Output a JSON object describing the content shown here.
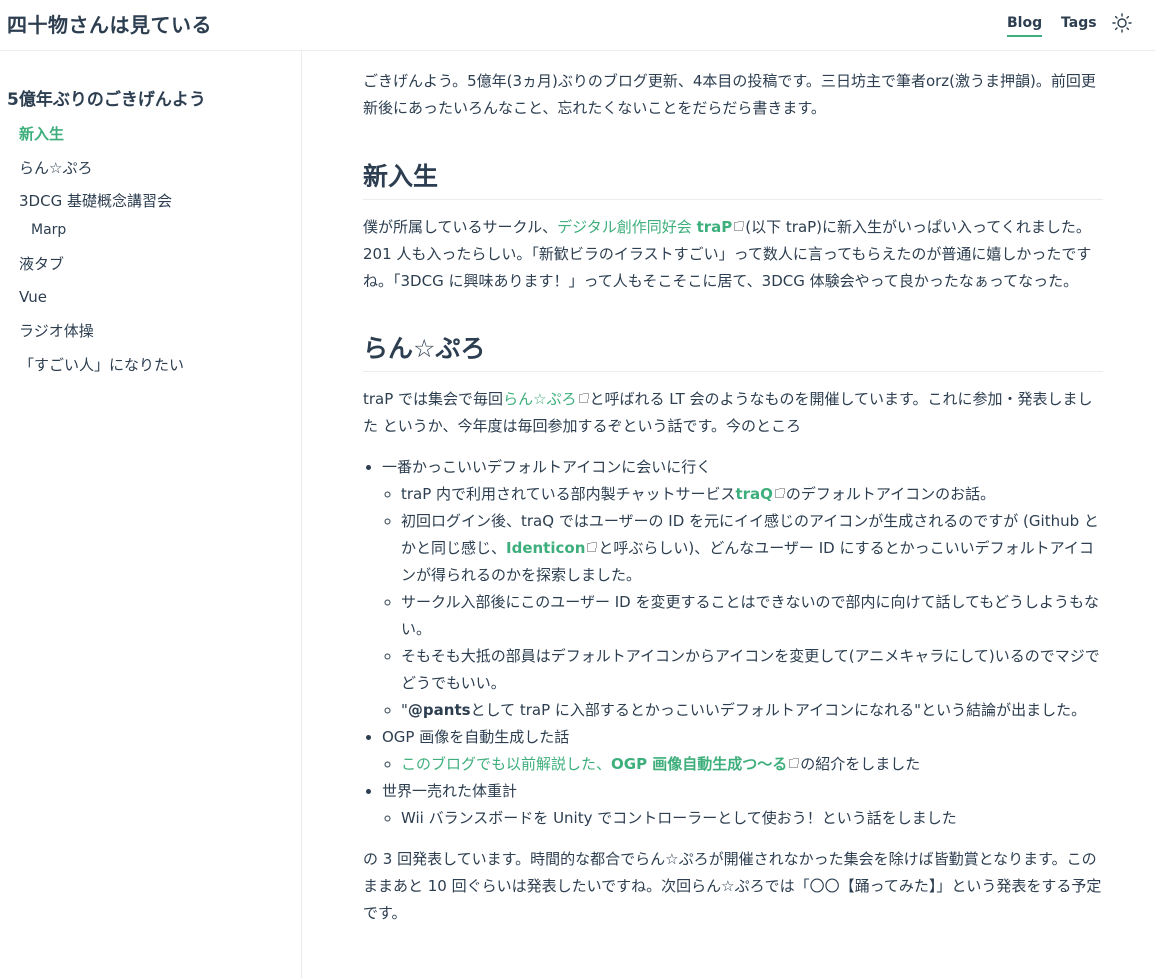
{
  "header": {
    "site_title": "四十物さんは見ている",
    "nav": [
      {
        "label": "Blog",
        "active": true
      },
      {
        "label": "Tags",
        "active": false
      }
    ],
    "theme_icon": "sun-icon"
  },
  "sidebar": {
    "title": "5億年ぶりのごきげんよう",
    "items": [
      {
        "label": "新入生",
        "active": true
      },
      {
        "label": "らん☆ぷろ"
      },
      {
        "label": "3DCG 基礎概念講習会"
      },
      {
        "label": "Marp",
        "sub": true
      },
      {
        "label": "液タブ"
      },
      {
        "label": "Vue"
      },
      {
        "label": "ラジオ体操"
      },
      {
        "label": "「すごい人」になりたい"
      }
    ]
  },
  "content": {
    "intro": "ごきげんよう。5億年(3ヵ月)ぶりのブログ更新、4本目の投稿です。三日坊主で筆者orz(激うま押韻)。前回更新後にあったいろんなこと、忘れたくないことをだらだら書きます。",
    "section1": {
      "heading": "新入生",
      "p_before": "僕が所属しているサークル、",
      "link1": "デジタル創作同好会",
      "link2": "traP",
      "p_after": "(以下 traP)に新入生がいっぱい入ってくれました。201 人も入ったらしい。「新歓ビラのイラストすごい」って数人に言ってもらえたのが普通に嬉しかったですね。「3DCG に興味あります！」って人もそこそこに居て、3DCG 体験会やって良かったなぁってなった。"
    },
    "section2": {
      "heading": "らん☆ぷろ",
      "p_before": "traP では集会で毎回",
      "link": "らん☆ぷろ",
      "p_after": "と呼ばれる LT 会のようなものを開催しています。これに参加・発表しました というか、今年度は毎回参加するぞという話です。今のところ",
      "list": {
        "item1": "一番かっこいいデフォルトアイコンに会いに行く",
        "item1_sub1_before": "traP 内で利用されている部内製チャットサービス",
        "item1_sub1_link": "traQ",
        "item1_sub1_after": "のデフォルトアイコンのお話。",
        "item1_sub2_before": "初回ログイン後、traQ ではユーザーの ID を元にイイ感じのアイコンが生成されるのですが (Github とかと同じ感じ、",
        "item1_sub2_link": "Identicon",
        "item1_sub2_after": "と呼ぶらしい)、どんなユーザー ID にするとかっこいいデフォルトアイコンが得られるのかを探索しました。",
        "item1_sub3": "サークル入部後にこのユーザー ID を変更することはできないので部内に向けて話してもどうしようもない。",
        "item1_sub4": "そもそも大抵の部員はデフォルトアイコンからアイコンを変更して(アニメキャラにして)いるのでマジでどうでもいい。",
        "item1_sub5_before": "\"",
        "item1_sub5_bold": "@pants",
        "item1_sub5_after": "として traP に入部するとかっこいいデフォルトアイコンになれる\"という結論が出ました。",
        "item2": "OGP 画像を自動生成した話",
        "item2_sub1_link_a": "このブログでも以前解説した、",
        "item2_sub1_link_b": "OGP 画像自動生成つ〜る",
        "item2_sub1_after": "の紹介をしました",
        "item3": "世界一売れた体重計",
        "item3_sub1": "Wii バランスボードを Unity でコントローラーとして使おう！という話をしました"
      },
      "closing": "の 3 回発表しています。時間的な都合でらん☆ぷろが開催されなかった集会を除けば皆勤賞となります。このままあと 10 回ぐらいは発表したいですね。次回らん☆ぷろでは「〇〇【踊ってみた】」という発表をする予定です。"
    }
  }
}
